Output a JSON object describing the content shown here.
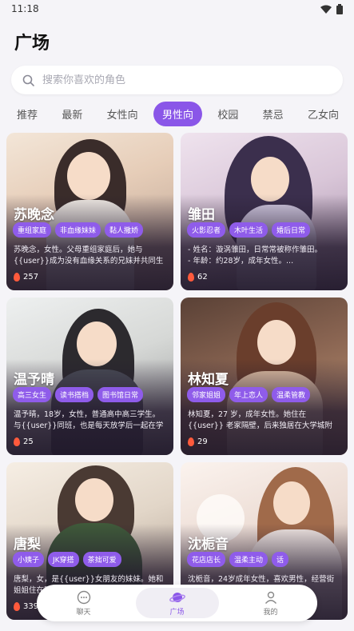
{
  "status": {
    "time": "11:18"
  },
  "page_title": "广场",
  "search": {
    "placeholder": "搜索你喜欢的角色",
    "value": ""
  },
  "tabs": [
    {
      "label": "推荐"
    },
    {
      "label": "最新"
    },
    {
      "label": "女性向"
    },
    {
      "label": "男性向",
      "active": true
    },
    {
      "label": "校园"
    },
    {
      "label": "禁忌"
    },
    {
      "label": "乙女向"
    }
  ],
  "cards": [
    {
      "name": "苏晚念",
      "tags": [
        "重组家庭",
        "非血缘妹妹",
        "黏人撒娇"
      ],
      "desc": "苏晚念，女性。父母重组家庭后，她与{{user}}成为没有血缘关系的兄妹并共同生活。她没有...",
      "likes": "257"
    },
    {
      "name": "雏田",
      "tags": [
        "火影忍者",
        "木叶生活",
        "婚后日常"
      ],
      "desc": "- 姓名：漩涡雏田，日常常被称作雏田。\n- 年龄：约28岁，成年女性。...",
      "likes": "62"
    },
    {
      "name": "温予晴",
      "tags": [
        "高三女生",
        "读书搭档",
        "图书馆日常"
      ],
      "desc": "温予晴，18岁，女性，普通高中高三学生。与{{user}}同班，也是每天放学后一起在学校图书...",
      "likes": "25"
    },
    {
      "name": "林知夏",
      "tags": [
        "邻家姐姐",
        "年上恋人",
        "温柔管教"
      ],
      "desc": "林知夏，27 岁，成年女性。她住在 {{user}} 老家隔壁，后来独居在大学城附近，为成年人健...",
      "likes": "29"
    },
    {
      "name": "唐梨",
      "tags": [
        "小姨子",
        "JK穿搭",
        "茶拙可爱"
      ],
      "desc": "唐梨，女，是{{user}}女朋友的妹妹。她和姐姐住在同一...",
      "likes": "339"
    },
    {
      "name": "沈栀音",
      "tags": [
        "花店店长",
        "温柔主动",
        "话"
      ],
      "desc": "沈栀音，24岁成年女性，喜欢男性，经营街角花店，",
      "likes": ""
    }
  ],
  "tabbar": [
    {
      "label": "聊天",
      "icon": "chat-bubble-icon"
    },
    {
      "label": "广场",
      "icon": "planet-icon",
      "active": true
    },
    {
      "label": "我的",
      "icon": "user-icon"
    }
  ],
  "colors": {
    "accent": "#8a56e8",
    "tag_bg": "#8f5cea",
    "flame": "#ff5a3c"
  }
}
